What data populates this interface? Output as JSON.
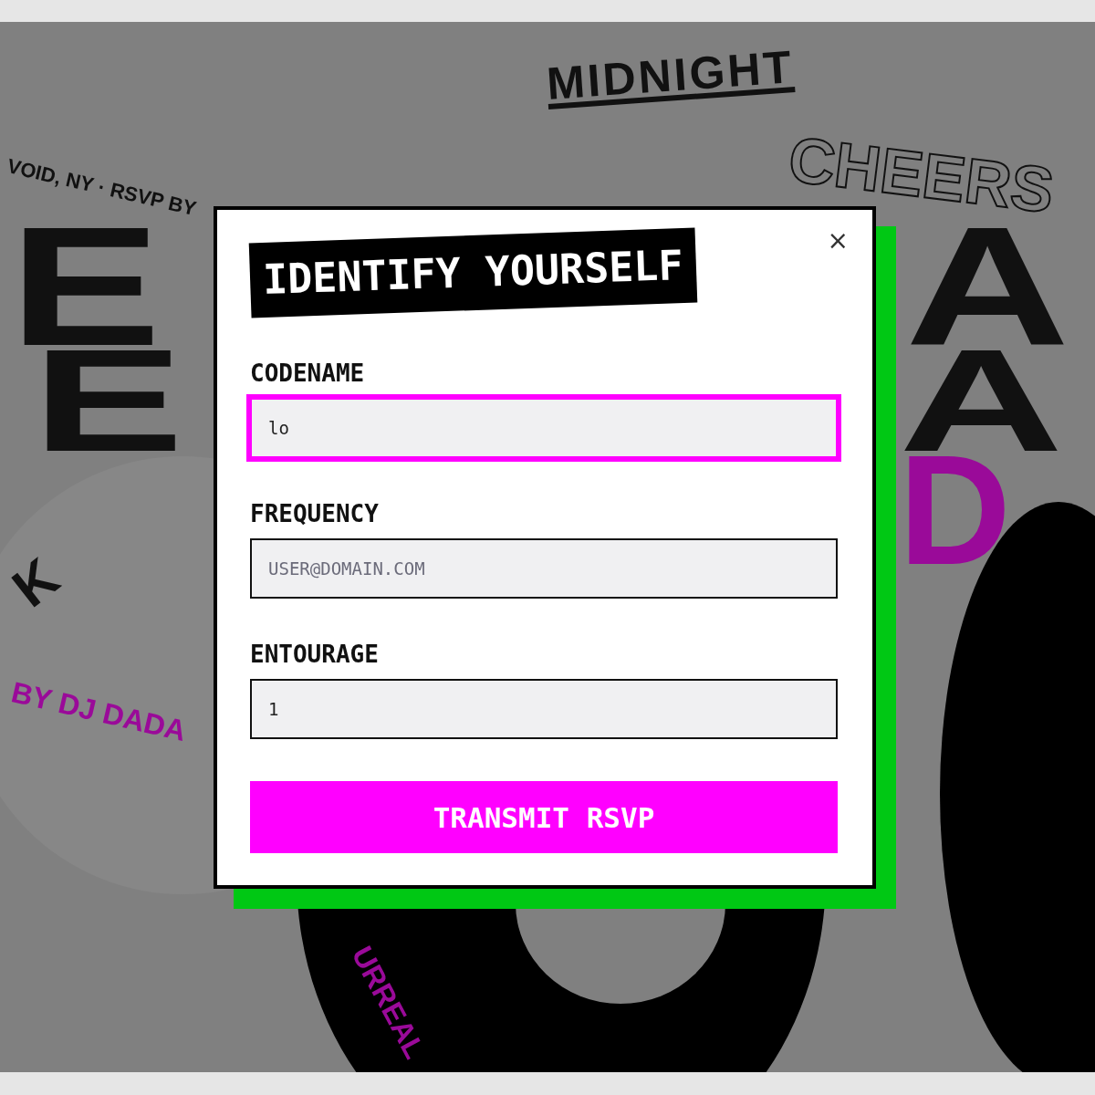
{
  "poster": {
    "texts": [
      {
        "text": "VOID, NY · RSVP BY",
        "kind": "caption"
      },
      {
        "text": "MIDNIGHT",
        "kind": "underlined"
      },
      {
        "text": "CHEERS",
        "kind": "outline"
      },
      {
        "text": "E",
        "kind": "giant"
      },
      {
        "text": "E",
        "kind": "giant"
      },
      {
        "text": "A",
        "kind": "giant"
      },
      {
        "text": "A",
        "kind": "giant"
      },
      {
        "text": "D",
        "kind": "accent",
        "color": "#9a0a99"
      },
      {
        "text": "K",
        "kind": "caption"
      },
      {
        "text": "BY DJ DADA",
        "kind": "caption",
        "color": "#9a0a99"
      },
      {
        "text": "URREAL",
        "kind": "caption",
        "color": "#9a0a99"
      }
    ]
  },
  "dialog": {
    "title": "IDENTIFY YOURSELF",
    "close": "×",
    "fields": [
      {
        "label": "CODENAME",
        "value": "lo",
        "focused": true
      },
      {
        "label": "FREQUENCY",
        "placeholder": "USER@DOMAIN.COM",
        "focused": false
      },
      {
        "label": "ENTOURAGE",
        "value": "1",
        "focused": false
      }
    ],
    "submit": "TRANSMIT RSVP"
  }
}
